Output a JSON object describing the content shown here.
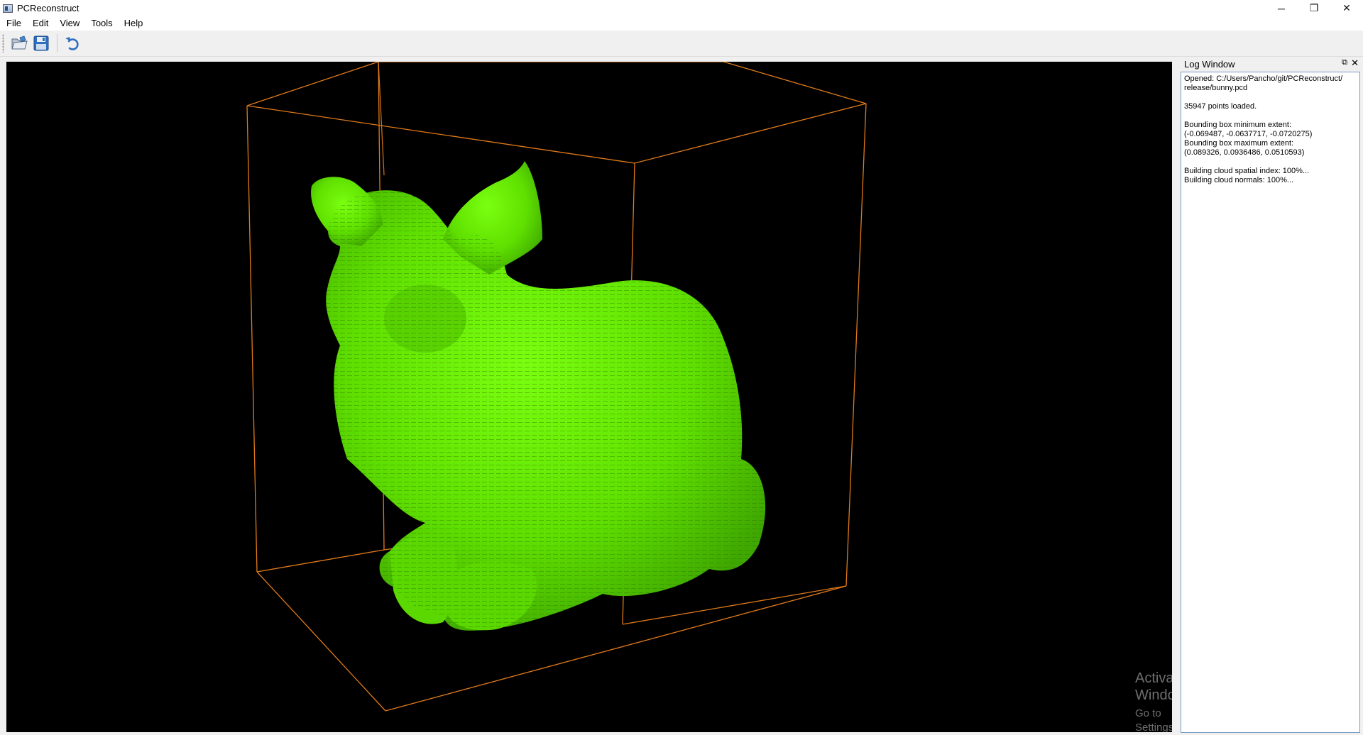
{
  "window": {
    "title": "PCReconstruct",
    "controls": {
      "minimize": "─",
      "restore": "❐",
      "close": "✕"
    }
  },
  "menu": [
    "File",
    "Edit",
    "View",
    "Tools",
    "Help"
  ],
  "toolbar": {
    "buttons": [
      {
        "icon": "open-folder-icon",
        "label": "Open"
      },
      {
        "icon": "save-disk-icon",
        "label": "Save"
      },
      {
        "icon": "undo-icon",
        "label": "Undo"
      }
    ]
  },
  "viewport": {
    "background": "#000000",
    "cloud_color": "#66ee00",
    "bbox_color": "#e07a1a"
  },
  "log_window": {
    "title": "Log Window",
    "float_icon": "⧉",
    "close_icon": "✕",
    "lines": [
      "Opened: C:/Users/Pancho/git/PCReconstruct/",
      "release/bunny.pcd",
      "",
      "35947 points loaded.",
      "",
      "Bounding box minimum extent:",
      "(-0.069487, -0.0637717, -0.0720275)",
      "Bounding box maximum extent:",
      "(0.089326, 0.0936486, 0.0510593)",
      "",
      "Building cloud spatial index: 100%...",
      "Building cloud normals: 100%..."
    ]
  },
  "watermark": {
    "title": "Activate Windows",
    "subtitle": "Go to Settings to activate Windows."
  }
}
